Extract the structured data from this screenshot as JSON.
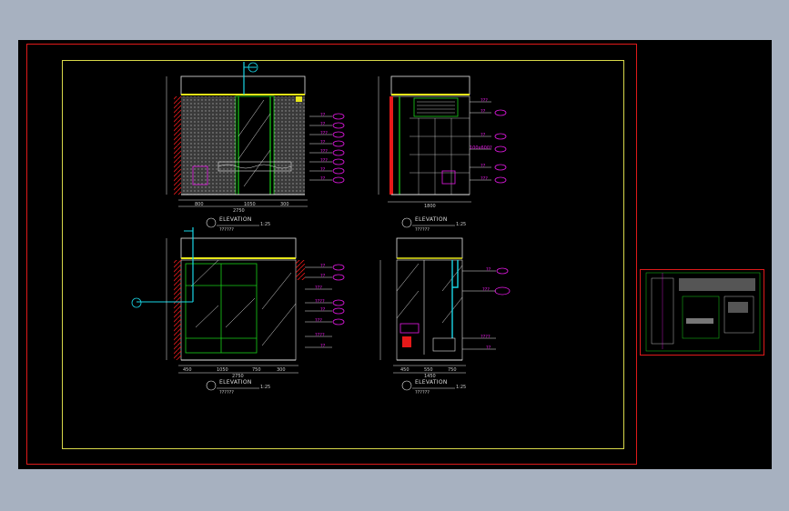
{
  "elevations": [
    {
      "title": "ELEVATION",
      "scale": "1:25",
      "subtitle": "??????",
      "mark": "01"
    },
    {
      "title": "ELEVATION",
      "scale": "1:25",
      "subtitle": "??????",
      "mark": "02"
    },
    {
      "title": "ELEVATION",
      "scale": "1:25",
      "subtitle": "??????",
      "mark": "03"
    },
    {
      "title": "ELEVATION",
      "scale": "1:25",
      "subtitle": "??????",
      "mark": "04"
    }
  ],
  "colors": {
    "background": "#000000",
    "app_background": "#a7b1c0",
    "sheet_border": "#e01a1a",
    "inner_frame": "#d8d84a",
    "green": "#19d119",
    "yellow": "#e6e619",
    "magenta": "#e619e6",
    "cyan": "#19d6e6",
    "red": "#e01a1a",
    "white": "#e6e6e6"
  },
  "dimension_labels": {
    "elev1_bottom": [
      "800",
      "1050",
      "300"
    ],
    "elev1_total": "2750",
    "elev2_bottom": "1800",
    "elev3_bottom": [
      "450",
      "1050",
      "750",
      "300"
    ],
    "elev3_total": "2750",
    "elev4_bottom": [
      "450",
      "550",
      "750"
    ],
    "elev4_total": "1450"
  },
  "callouts": {
    "elev1": [
      "??",
      "??",
      "???",
      "??",
      "???",
      "???",
      "??",
      "??"
    ],
    "elev2": [
      "???",
      "??",
      "??",
      "100x600?",
      "??",
      "???"
    ],
    "elev3": [
      "??",
      "??",
      "???",
      "????",
      "??",
      "???",
      "????",
      "??"
    ],
    "elev4": [
      "??",
      "???",
      "????",
      "??"
    ]
  }
}
